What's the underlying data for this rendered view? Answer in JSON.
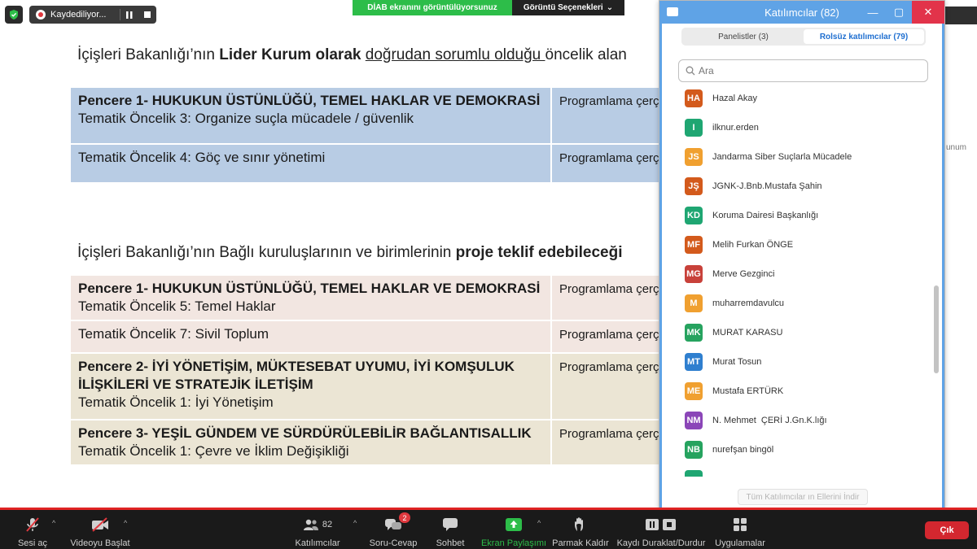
{
  "top": {
    "recording_label": "Kaydediliyor...",
    "sharing_status": "DİAB ekranını görüntülüyorsunuz",
    "view_options": "Görüntü Seçenekleri",
    "clipped_text": "unum"
  },
  "slide": {
    "heading1": {
      "a": "İçişleri Bakanlığı’nın ",
      "b": "Lider Kurum olarak",
      "c": " ",
      "u": "doğrudan sorumlu olduğu ",
      "d": "öncelik alan"
    },
    "table1": [
      {
        "title": "Pencere 1- HUKUKUN ÜSTÜNLÜĞÜ, TEMEL HAKLAR VE DEMOKRASİ",
        "sub": "Tematik Öncelik 3: Organize suçla mücadele / güvenlik",
        "right": "Programlama çerç"
      },
      {
        "title": "",
        "sub": "Tematik Öncelik 4: Göç ve sınır yönetimi",
        "right": "Programlama çerç"
      }
    ],
    "heading2": {
      "a": "İçişleri Bakanlığı’nın Bağlı kuruluşlarının ve birimlerinin ",
      "b": "proje teklif edebileceği"
    },
    "table2": [
      {
        "title": "Pencere 1- HUKUKUN ÜSTÜNLÜĞÜ, TEMEL HAKLAR VE DEMOKRASİ",
        "title2": "",
        "sub": "Tematik Öncelik 5: Temel Haklar",
        "right": "Programlama çerç"
      },
      {
        "title": "",
        "title2": "",
        "sub": "Tematik Öncelik 7: Sivil Toplum",
        "right": "Programlama çerç"
      },
      {
        "title": "Pencere 2- İYİ YÖNETİŞİM, MÜKTESEBAT UYUMU, İYİ KOMŞULUK",
        "title2": "İLİŞKİLERİ VE STRATEJİK İLETİŞİM",
        "sub": "Tematik Öncelik 1: İyi Yönetişim",
        "right": "Programlama çerç"
      },
      {
        "title": "Pencere 3- YEŞİL GÜNDEM VE SÜRDÜRÜLEBİLİR BAĞLANTISALLIK",
        "title2": "",
        "sub": "Tematik Öncelik 1: Çevre ve İklim Değişikliği",
        "right": "Programlama çerç"
      }
    ]
  },
  "panel": {
    "title": "Katılımcılar (82)",
    "tab_panelists": "Panelistler (3)",
    "tab_attendees": "Rolsüz katılımcılar (79)",
    "search_placeholder": "Ara",
    "lower_all_hands": "Tüm Katılımcılar ın Ellerini İndir",
    "participants": [
      {
        "initials": "HA",
        "name": "Hazal Akay",
        "color": "#d35a1c"
      },
      {
        "initials": "I",
        "name": "ilknur.erden",
        "color": "#1fa672"
      },
      {
        "initials": "JS",
        "name": "Jandarma Siber Suçlarla Mücadele",
        "color": "#f0a030"
      },
      {
        "initials": "JŞ",
        "name": "JGNK-J.Bnb.Mustafa Şahin",
        "color": "#d35a1c"
      },
      {
        "initials": "KD",
        "name": "Koruma Dairesi Başkanlığı",
        "color": "#1fa672"
      },
      {
        "initials": "MF",
        "name": "Melih Furkan ÖNGE",
        "color": "#d35a1c"
      },
      {
        "initials": "MG",
        "name": "Merve Gezginci",
        "color": "#c8413a"
      },
      {
        "initials": "M",
        "name": "muharremdavulcu",
        "color": "#f0a030"
      },
      {
        "initials": "MK",
        "name": "MURAT KARASU",
        "color": "#26a35f"
      },
      {
        "initials": "MT",
        "name": "Murat Tosun",
        "color": "#2f7fcf"
      },
      {
        "initials": "ME",
        "name": "Mustafa ERTÜRK",
        "color": "#f0a030"
      },
      {
        "initials": "NM",
        "name": "N. Mehmet  ÇERİ J.Gn.K.lığı",
        "color": "#8b46b8"
      },
      {
        "initials": "NB",
        "name": "nurefşan bingöl",
        "color": "#26a35f"
      }
    ]
  },
  "toolbar": {
    "mute": "Sesi aç",
    "video": "Videoyu Başlat",
    "participants": "Katılımcılar",
    "participants_count": "82",
    "qa": "Soru-Cevap",
    "qa_badge": "2",
    "chat": "Sohbet",
    "share": "Ekran Paylaşımı",
    "raise_hand": "Parmak Kaldır",
    "pause_recording": "Kaydı Duraklat/Durdur",
    "apps": "Uygulamalar",
    "exit": "Çık"
  }
}
